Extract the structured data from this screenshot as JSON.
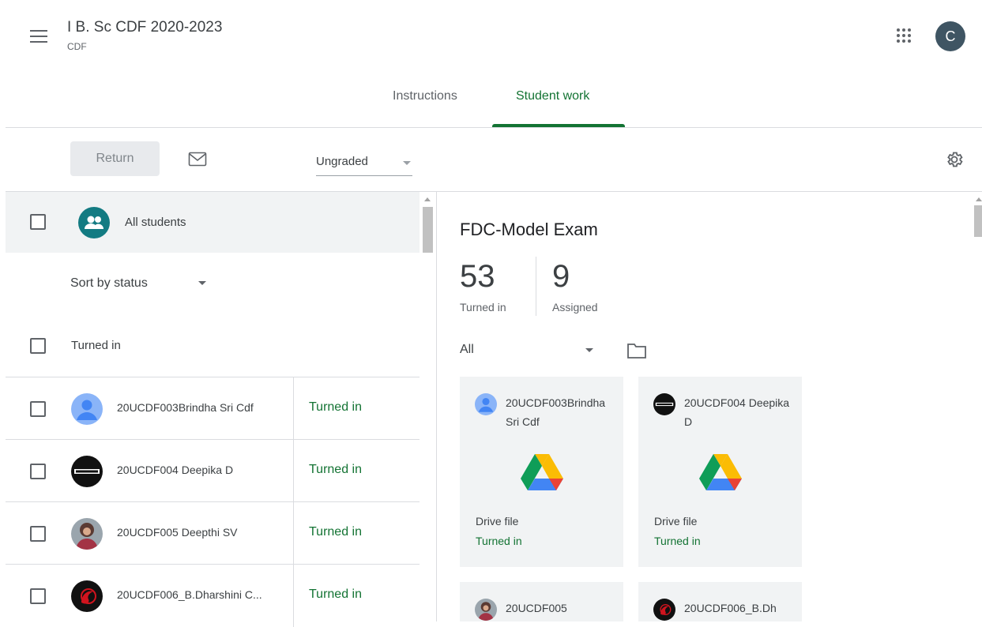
{
  "header": {
    "class_title": "I B. Sc CDF 2020-2023",
    "class_subtitle": "CDF",
    "profile_initial": "C"
  },
  "tabs": [
    {
      "label": "Instructions",
      "active": false
    },
    {
      "label": "Student work",
      "active": true
    }
  ],
  "toolbar": {
    "return_label": "Return",
    "grade_select": "Ungraded"
  },
  "left_panel": {
    "all_students_label": "All students",
    "sort_label": "Sort by status",
    "section_header": "Turned in",
    "students": [
      {
        "name": "20UCDF003Brindha Sri Cdf",
        "status": "Turned in",
        "avatar": "default-person"
      },
      {
        "name": "20UCDF004 Deepika D",
        "status": "Turned in",
        "avatar": "black-logo"
      },
      {
        "name": "20UCDF005 Deepthi SV",
        "status": "Turned in",
        "avatar": "photo"
      },
      {
        "name": "20UCDF006_B.Dharshini C...",
        "status": "Turned in",
        "avatar": "red-emblem"
      }
    ]
  },
  "right_panel": {
    "assignment_title": "FDC-Model Exam",
    "turned_in_count": "53",
    "turned_in_label": "Turned in",
    "assigned_count": "9",
    "assigned_label": "Assigned",
    "filter_label": "All",
    "cards": [
      {
        "name": "20UCDF003Brindha Sri Cdf",
        "file_type": "Drive file",
        "status": "Turned in",
        "avatar": "default-person"
      },
      {
        "name": "20UCDF004 Deepika D",
        "file_type": "Drive file",
        "status": "Turned in",
        "avatar": "black-logo"
      },
      {
        "name": "20UCDF005",
        "file_type": "",
        "status": "",
        "avatar": "photo"
      },
      {
        "name": "20UCDF006_B.Dh",
        "file_type": "",
        "status": "",
        "avatar": "red-emblem"
      }
    ]
  },
  "colors": {
    "accent_green": "#137333",
    "group_icon_teal": "#137b82",
    "avatar_bg": "#3f5563"
  }
}
